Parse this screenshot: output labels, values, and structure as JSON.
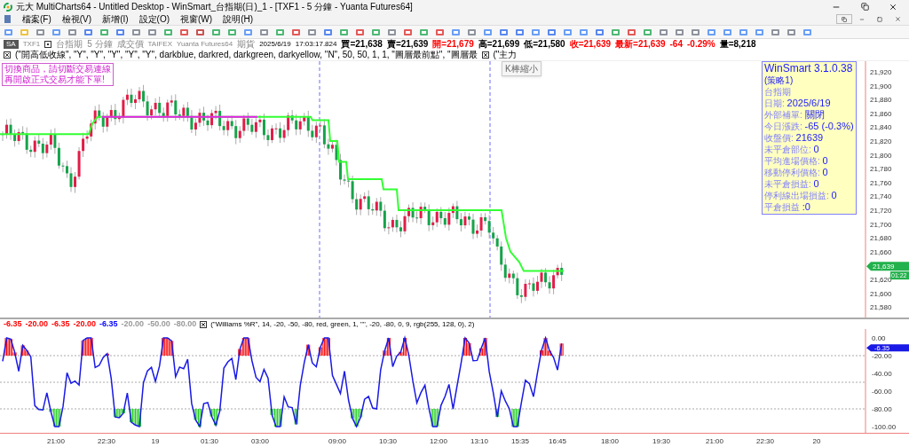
{
  "window": {
    "title": "元大 MultiCharts64 - Untitled Desktop - WinSmart_台指期(日)_1 - [TXF1 - 5 分鐘 - Yuanta Futures64]"
  },
  "menu": [
    "檔案(F)",
    "檢視(V)",
    "新增(I)",
    "設定(O)",
    "視窗(W)",
    "說明(H)"
  ],
  "chart_header": {
    "mode_button": "SA",
    "symbol": "TXF1",
    "name": "台指期",
    "interval": "5 分鐘",
    "price_type": "成交價",
    "exchange": "TAIFEX",
    "feed": "Yuanta Futures64",
    "category": "期貨",
    "date": "2025/6/19",
    "time": "17:03:17.824",
    "quotes": [
      {
        "text": "買=21,638",
        "color": "#000000"
      },
      {
        "text": "賣=21,639",
        "color": "#000000"
      },
      {
        "text": "開=21,679",
        "color": "#ff0000"
      },
      {
        "text": "高=21,699",
        "color": "#000000"
      },
      {
        "text": "低=21,580",
        "color": "#000000"
      },
      {
        "text": "收=21,639",
        "color": "#ff0000"
      },
      {
        "text": "最新=21,639",
        "color": "#ff0000"
      },
      {
        "text": "-64",
        "color": "#ff0000"
      },
      {
        "text": "-0.29%",
        "color": "#ff0000"
      },
      {
        "text": "量=8,218",
        "color": "#000000"
      }
    ],
    "studies": [
      "(\"開高低收線\", \"Y\", \"Y\", \"Y\", \"Y\", \"Y\", darkblue, darkred, darkgreen, darkyellow, \"N\", 50, 50, 1, 1, \"圖層最前點\", \"圖層最",
      "(\"主力"
    ]
  },
  "tooltip": "K棒縮小",
  "notice": [
    "切換商品，請切斷交易連線",
    "再開啟正式交易才能下單!"
  ],
  "info_box": {
    "title": "WinSmart 3.1.0.38",
    "subtitle": "(策略1)",
    "product": "台指期",
    "rows": [
      {
        "label": "日期: ",
        "value": "2025/6/19"
      },
      {
        "label": "外部補單: ",
        "value": "關閉"
      },
      {
        "label": "今日漲跌: ",
        "value": "-65 (-0.3%)"
      },
      {
        "label": "收盤價: ",
        "value": "21639"
      },
      {
        "label": "未平倉部位: ",
        "value": "0"
      },
      {
        "label": "平均進場價格: ",
        "value": "0"
      },
      {
        "label": "移動停利價格: ",
        "value": "0"
      },
      {
        "label": "未平倉損益: ",
        "value": "0"
      },
      {
        "label": "停利線出場損益: ",
        "value": "0"
      },
      {
        "label": "平倉損益 ",
        "value": ":0"
      }
    ]
  },
  "price_axis": {
    "ticks": [
      "21,920",
      "21,900",
      "21,880",
      "21,860",
      "21,840",
      "21,820",
      "21,800",
      "21,780",
      "21,760",
      "21,740",
      "21,720",
      "21,700",
      "21,680",
      "21,660",
      "21,620",
      "21,600",
      "21,580"
    ],
    "last_price": "21,639",
    "countdown": "01:22"
  },
  "oscillator": {
    "values": [
      {
        "text": "-6.35",
        "color": "#ff0000"
      },
      {
        "text": "-20.00",
        "color": "#ff0000"
      },
      {
        "text": "-6.35",
        "color": "#ff0000"
      },
      {
        "text": "-20.00",
        "color": "#ff0000"
      },
      {
        "text": "-6.35",
        "color": "#0000ff"
      },
      {
        "text": "-20.00",
        "color": "#999999"
      },
      {
        "text": "-50.00",
        "color": "#999999"
      },
      {
        "text": "-80.00",
        "color": "#999999"
      }
    ],
    "label": "(\"Williams %R\", 14, -20, -50, -80, red, green, 1, \"\", -20, -80, 0, 9, rgb(255, 128, 0), 2)",
    "ticks": [
      "0.00",
      "-20.00",
      "-40.00",
      "-60.00",
      "-80.00",
      "-100.00"
    ],
    "last_value": "-6.35"
  },
  "time_axis": [
    "21:00",
    "22:30",
    "19",
    "01:30",
    "03:00",
    "09:00",
    "10:30",
    "12:00",
    "13:10",
    "15:35",
    "16:45",
    "18:00",
    "19:30",
    "21:00",
    "22:30",
    "20"
  ]
}
